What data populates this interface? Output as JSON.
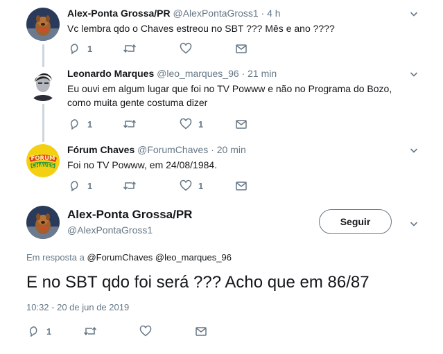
{
  "replies": [
    {
      "name": "Alex-Ponta Grossa/PR",
      "handle": "@AlexPontaGross1",
      "time": "4 h",
      "text": "Vc lembra qdo o Chaves estreou no SBT ??? Mês e ano ????",
      "reply_count": "1",
      "like_count": ""
    },
    {
      "name": "Leonardo Marques",
      "handle": "@leo_marques_96",
      "time": "21 min",
      "text_line1": "Eu ouvi em algum lugar que foi no TV Powww e não no Programa do Bozo,",
      "text_line2": "como muita gente costuma dizer",
      "reply_count": "1",
      "like_count": "1"
    },
    {
      "name": "Fórum Chaves",
      "handle": "@ForumChaves",
      "time": "20 min",
      "text": "Foi no TV Powww, em 24/08/1984.",
      "reply_count": "1",
      "like_count": "1",
      "avatar_text_top": "FÓRUM",
      "avatar_text_bottom": "CHAVES"
    }
  ],
  "main_tweet": {
    "name": "Alex-Ponta Grossa/PR",
    "handle": "@AlexPontaGross1",
    "follow_label": "Seguir",
    "reply_prefix": "Em resposta a",
    "reply_to": "@ForumChaves @leo_marques_96",
    "text": "E no SBT qdo foi será ??? Acho que em 86/87",
    "timestamp": "10:32 - 20 de jun de 2019",
    "reply_count": "1"
  },
  "separator": "·",
  "colors": {
    "link": "#1da1f2",
    "muted": "#657786",
    "text": "#14171a",
    "thread_line": "#ccd6dd"
  }
}
